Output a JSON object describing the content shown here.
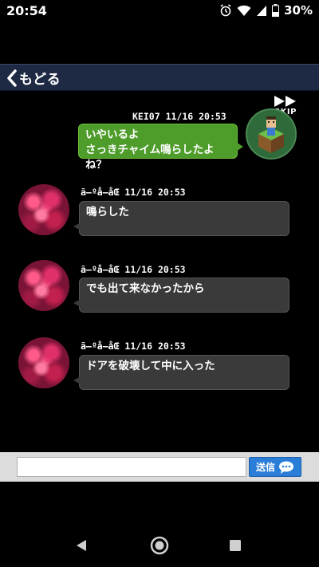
{
  "status_bar": {
    "time": "20:54",
    "battery": "30%"
  },
  "header": {
    "back_label": "もどる"
  },
  "skip": {
    "label": "SKIP"
  },
  "messages": [
    {
      "sender": "KEI07",
      "timestamp": "11/16 20:53",
      "lines": [
        "いやいるよ",
        "さっきチャイム鳴らしたよね？"
      ],
      "direction": "outgoing"
    },
    {
      "sender": "ã–ºå–åŒ",
      "timestamp": "11/16 20:53",
      "lines": [
        "鳴らした"
      ],
      "direction": "incoming"
    },
    {
      "sender": "ã–ºå–åŒ",
      "timestamp": "11/16 20:53",
      "lines": [
        "でも出て来なかったから"
      ],
      "direction": "incoming"
    },
    {
      "sender": "ã–ºå–åŒ",
      "timestamp": "11/16 20:53",
      "lines": [
        "ドアを破壊して中に入った"
      ],
      "direction": "incoming"
    }
  ],
  "input": {
    "value": "",
    "placeholder": ""
  },
  "send_button": {
    "label": "送信"
  },
  "colors": {
    "header_bg": "#1e2a44",
    "outgoing_bubble": "#4e9c2a",
    "incoming_bubble": "#3a3a3a",
    "send_button": "#2a7ed8"
  },
  "icons": [
    "alarm-icon",
    "wifi-icon",
    "signal-icon",
    "battery-icon",
    "back-chevron-icon",
    "fast-forward-icon",
    "chat-bubble-icon",
    "nav-back-icon",
    "nav-home-icon",
    "nav-recent-icon"
  ]
}
